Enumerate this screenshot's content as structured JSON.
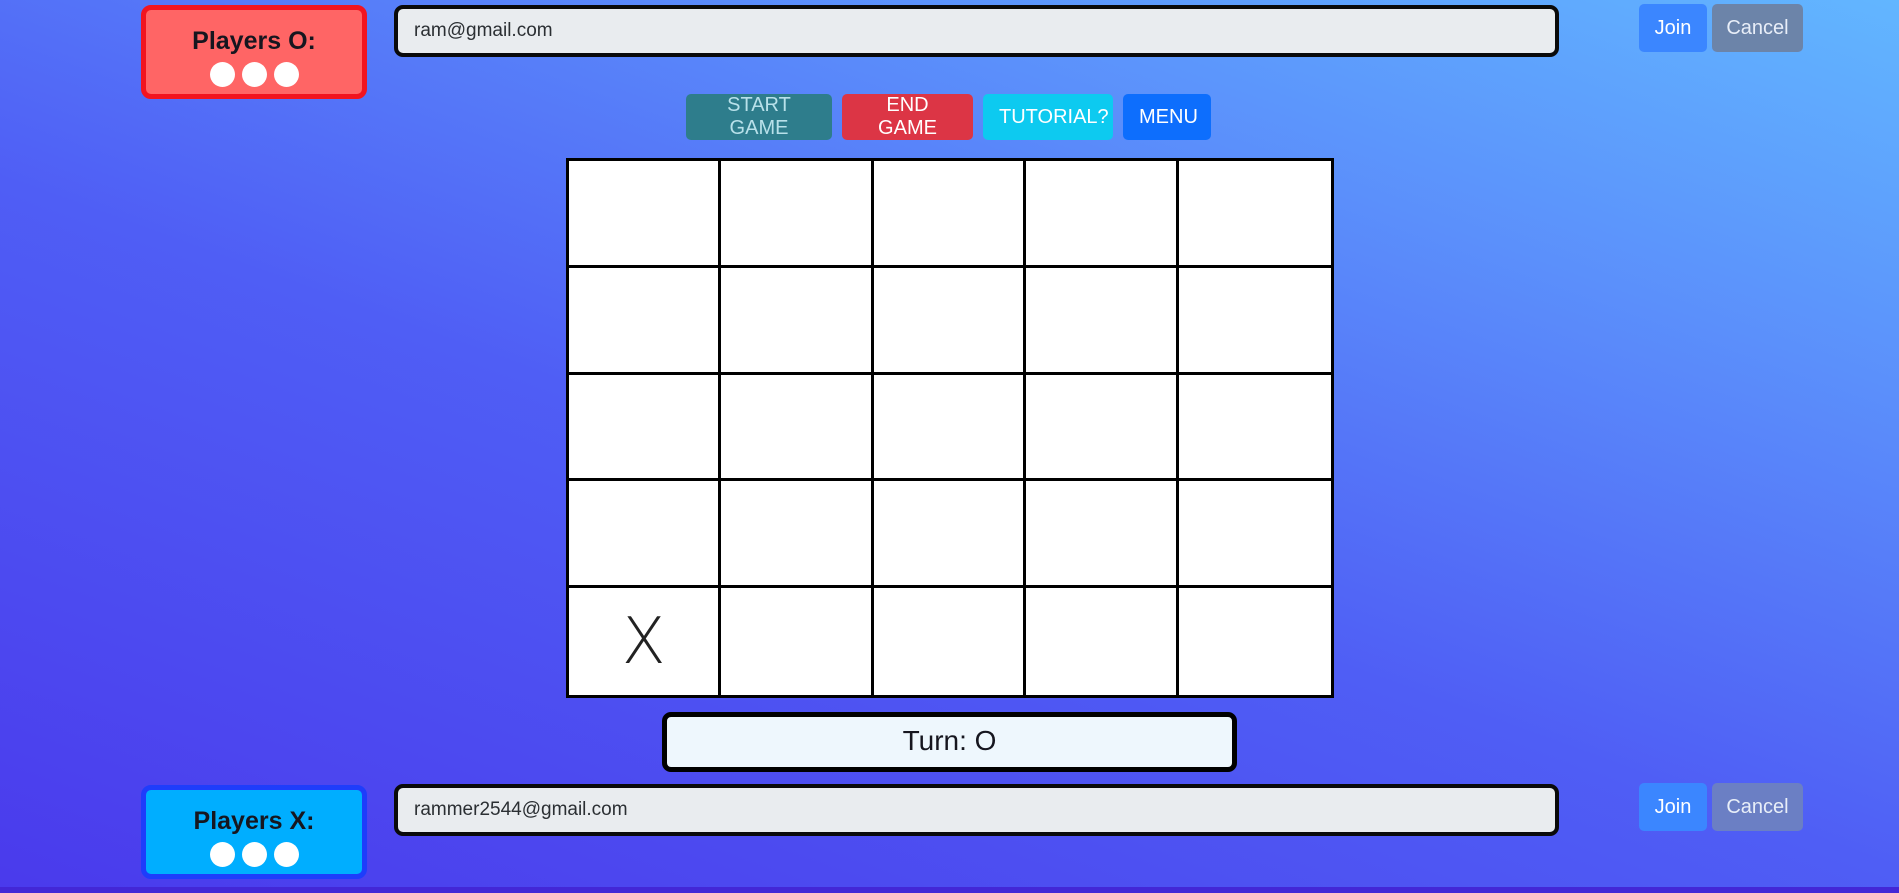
{
  "player_o": {
    "title": "Players O:",
    "slots": 3,
    "email_value": "ram@gmail.com",
    "join_label": "Join",
    "cancel_label": "Cancel"
  },
  "player_x": {
    "title": "Players X:",
    "slots": 3,
    "email_value": "rammer2544@gmail.com",
    "join_label": "Join",
    "cancel_label": "Cancel"
  },
  "controls": {
    "start_label": "START GAME",
    "end_label": "END GAME",
    "tutorial_label": "TUTORIAL?",
    "menu_label": "MENU"
  },
  "board": {
    "rows": [
      [
        "",
        "",
        "",
        "",
        ""
      ],
      [
        "",
        "",
        "",
        "",
        ""
      ],
      [
        "",
        "",
        "",
        "",
        ""
      ],
      [
        "",
        "",
        "",
        "",
        ""
      ],
      [
        "X",
        "",
        "",
        "",
        ""
      ]
    ]
  },
  "turn": {
    "text": "Turn: O"
  },
  "colors": {
    "player_o_bg": "#ff6565",
    "player_o_border": "#f2141f",
    "player_x_bg": "#00aeff",
    "player_x_border": "#1e3dfb",
    "start": "#2e7d8c",
    "end": "#dc3545",
    "tutorial": "#0dcaf0",
    "menu": "#0d6efd"
  }
}
